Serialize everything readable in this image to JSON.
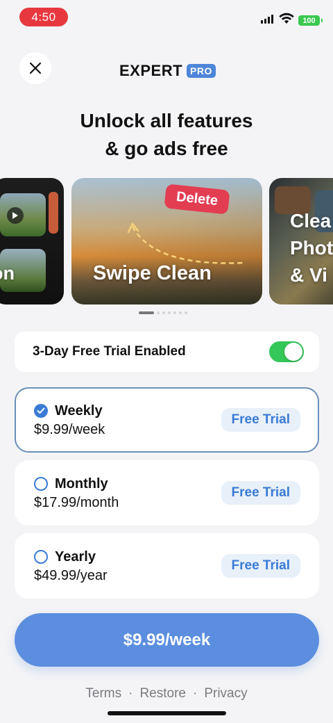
{
  "status_bar": {
    "time": "4:50",
    "battery": "100"
  },
  "header": {
    "brand_name": "EXPERT",
    "brand_badge": "PRO"
  },
  "headline": {
    "line1": "Unlock all features",
    "line2": "& go ads free"
  },
  "carousel": {
    "left_card_label": "on",
    "main_card_label": "Swipe Clean",
    "main_card_tag": "Delete",
    "right_card_lines": [
      "Clea",
      "Phot",
      "& Vi"
    ]
  },
  "trial": {
    "label": "3-Day Free Trial Enabled",
    "enabled": true
  },
  "plans": [
    {
      "name": "Weekly",
      "price": "$9.99/week",
      "badge": "Free Trial",
      "selected": true
    },
    {
      "name": "Monthly",
      "price": "$17.99/month",
      "badge": "Free Trial",
      "selected": false
    },
    {
      "name": "Yearly",
      "price": "$49.99/year",
      "badge": "Free Trial",
      "selected": false
    }
  ],
  "cta": {
    "label": "$9.99/week"
  },
  "footer": {
    "terms": "Terms",
    "separator": "·",
    "restore": "Restore",
    "privacy": "Privacy"
  },
  "colors": {
    "accent": "#3a7bd5",
    "cta": "#5b8ede",
    "toggle_on": "#34c759",
    "time_pill": "#e8383f"
  }
}
